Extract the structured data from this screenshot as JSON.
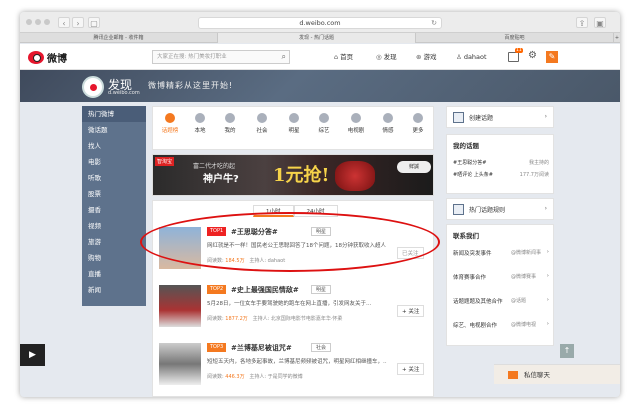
{
  "browser": {
    "url": "d.weibo.com",
    "tabs": [
      "腾讯企业邮箱 - 收件箱",
      "发现 - 热门话题",
      "百度贴吧"
    ]
  },
  "topnav": {
    "brand": "微博",
    "search_placeholder": "大家正在搜: 热门美妆打职业",
    "items": [
      "首页",
      "发现",
      "游戏",
      "dahaot"
    ],
    "msg_badge": "11"
  },
  "banner": {
    "title": "发现",
    "sub": "d.weibo.com",
    "slogan": "微博精彩从这里开始!"
  },
  "sidebar": {
    "items": [
      "热门微博",
      "微话题",
      "找人",
      "电影",
      "听歌",
      "股票",
      "摄香",
      "视频",
      "旅游",
      "购物",
      "直播",
      "新闻"
    ]
  },
  "categories": [
    "话题榜",
    "本地",
    "我的",
    "社会",
    "明星",
    "综艺",
    "电视剧",
    "情感",
    "更多"
  ],
  "ad": {
    "tag": "智淘宝",
    "t1": "富二代才吃的起",
    "t2": "神户牛?",
    "t3": "1元抢!",
    "brand": "鲜誠"
  },
  "feed": {
    "filters": [
      "1小时",
      "24小时"
    ],
    "rows": [
      {
        "rank": "TOP1",
        "title": "#王思聪分答#",
        "label": "明星",
        "desc": "网红就是不一样！国民老公王思聪回答了18个问题，18分钟获取收入超人！",
        "reads_label": "阅读数:",
        "reads": "184.5万",
        "host": "主持人: dahaot",
        "follow": "已关注"
      },
      {
        "rank": "TOP2",
        "title": "#史上最强国民情敌#",
        "label": "明星",
        "desc": "5月28日，一位女车手要驾驶她的跑车在网上直播，引发网友关于…",
        "reads_label": "阅读数:",
        "reads": "1877.2万",
        "host": "主持人: 北京国际电影节电影嘉年华·怀柔",
        "follow": "+ 关注"
      },
      {
        "rank": "TOP3",
        "title": "#兰博基尼被诅咒#",
        "label": "社会",
        "desc": "短短五天内，各地多起事故，兰博基尼频频被诅咒，明星网红相继撞车，…",
        "reads_label": "阅读数:",
        "reads": "446.3万",
        "host": "主持人: 于是同学的微博",
        "follow": "+ 关注"
      }
    ]
  },
  "right": {
    "create": "创建话题",
    "mine": {
      "title": "我的话题",
      "items": [
        {
          "name": "#王思聪分答#",
          "role": "我主持的"
        },
        {
          "name": "#晒评论 上头条#",
          "role": "177.7万阅读"
        }
      ]
    },
    "rules": "热门话题规则",
    "contact": {
      "title": "联系我们",
      "items": [
        {
          "name": "新闻及突发事件",
          "src": "@微博新闻事"
        },
        {
          "name": "体育赛事合作",
          "src": "@微博赛事"
        },
        {
          "name": "话题题题及其他合作",
          "src": "@话题"
        },
        {
          "name": "综艺、电视剧合作",
          "src": "@微博电视"
        }
      ]
    }
  },
  "chat": "私信聊天"
}
